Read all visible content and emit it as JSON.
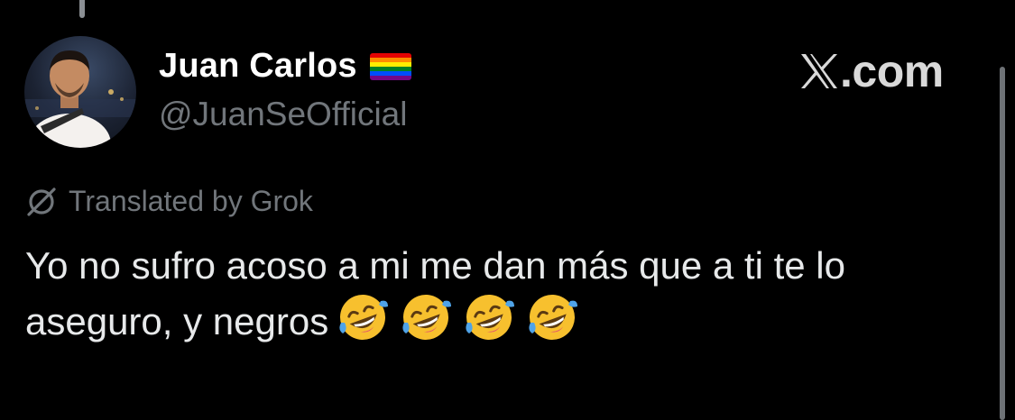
{
  "author": {
    "display_name": "Juan Carlos",
    "badge_emoji": "rainbow-flag",
    "handle": "@JuanSeOfficial"
  },
  "source": {
    "logo": "x-logo",
    "label": ".com"
  },
  "translation": {
    "icon": "grok-icon",
    "label": "Translated by Grok"
  },
  "tweet": {
    "text": "Yo no sufro acoso a mi me dan más que a ti te lo aseguro, y negros",
    "emojis": [
      "rolling-on-floor-laughing",
      "rolling-on-floor-laughing",
      "rolling-on-floor-laughing",
      "rolling-on-floor-laughing"
    ]
  },
  "colors": {
    "background": "#000000",
    "primary_text": "#e7e9ea",
    "secondary_text": "#71767b"
  }
}
